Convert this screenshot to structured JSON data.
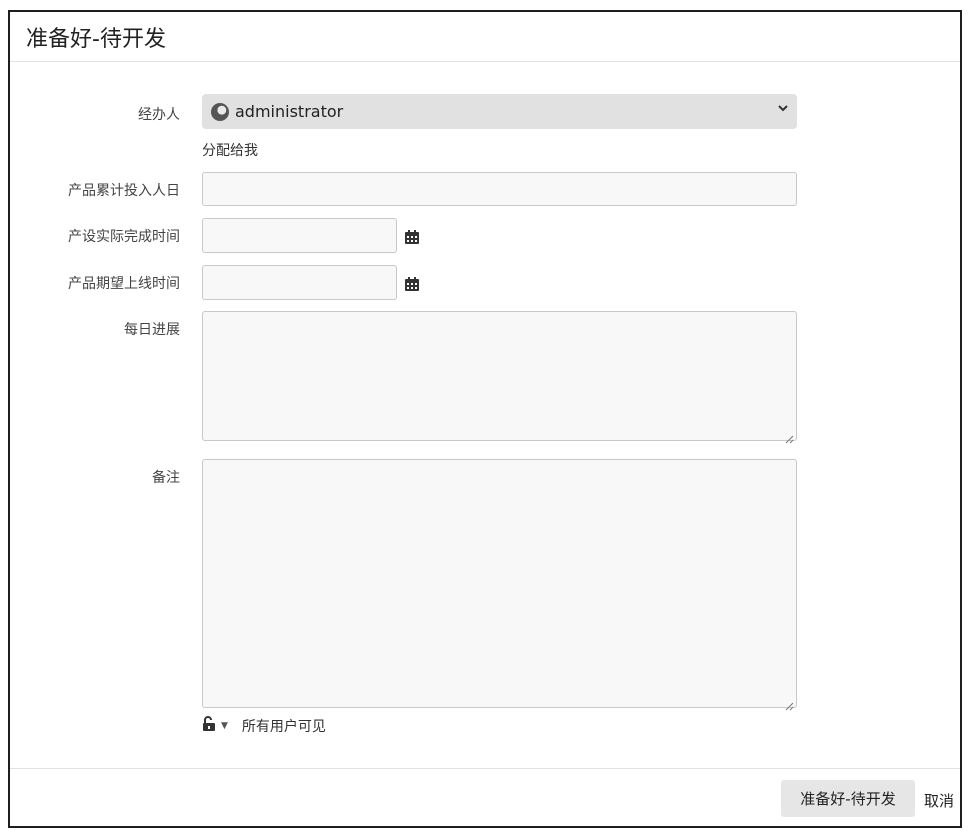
{
  "dialog": {
    "title": "准备好-待开发"
  },
  "form": {
    "assignee": {
      "label": "经办人",
      "selected": "administrator",
      "assign_to_me": "分配给我"
    },
    "man_days": {
      "label": "产品累计投入人日",
      "value": ""
    },
    "actual_finish": {
      "label": "产设实际完成时间",
      "value": "",
      "icon": "calendar-icon"
    },
    "expected_launch": {
      "label": "产品期望上线时间",
      "value": "",
      "icon": "calendar-icon"
    },
    "daily_progress": {
      "label": "每日进展",
      "value": ""
    },
    "remarks": {
      "label": "备注",
      "value": ""
    },
    "visibility": {
      "icon": "unlock-icon",
      "text": "所有用户可见"
    }
  },
  "footer": {
    "submit_label": "准备好-待开发",
    "cancel_label": "取消"
  }
}
